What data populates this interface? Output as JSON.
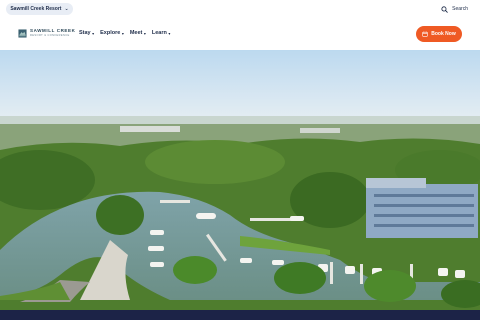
{
  "topbar": {
    "resort_switcher_label": "Sawmill Creek Resort",
    "search_label": "Search"
  },
  "nav": {
    "logo_name": "SAWMILL CREEK",
    "logo_sub": "RESORT & CONFERENCE",
    "items": [
      {
        "label": "Stay"
      },
      {
        "label": "Explore"
      },
      {
        "label": "Meet"
      },
      {
        "label": "Learn"
      }
    ],
    "book_label": "Book Now"
  },
  "icons": {
    "search": "search-icon",
    "calendar": "calendar-icon",
    "chevron": "chevron-down-icon",
    "logo": "logo-icon"
  },
  "colors": {
    "navy": "#1f2d4a",
    "accent": "#ef5a24",
    "footer": "#1c2347"
  }
}
